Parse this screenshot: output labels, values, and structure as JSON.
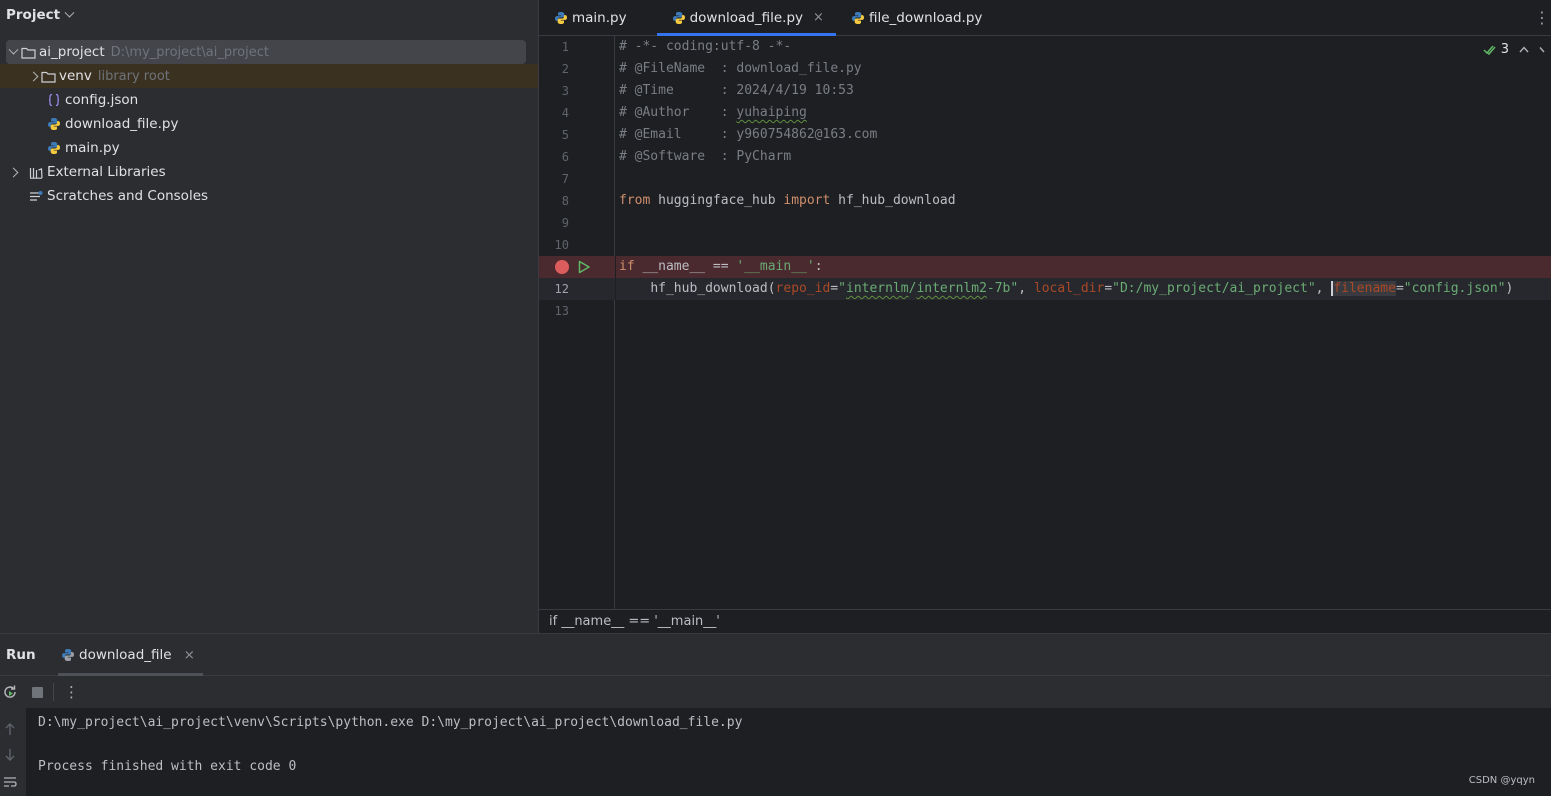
{
  "project": {
    "title": "Project",
    "tree": [
      {
        "name": "ai_project",
        "hint": "D:\\my_project\\ai_project"
      },
      {
        "name": "venv",
        "hint": "library root"
      },
      {
        "name": "config.json"
      },
      {
        "name": "download_file.py"
      },
      {
        "name": "main.py"
      },
      {
        "name": "External Libraries"
      },
      {
        "name": "Scratches and Consoles"
      }
    ]
  },
  "editor": {
    "tabs": [
      {
        "label": "main.py"
      },
      {
        "label": "download_file.py"
      },
      {
        "label": "file_download.py"
      }
    ],
    "close_symbol": "×",
    "more_symbol": "⋮",
    "check_count": "3",
    "line_numbers": [
      "1",
      "2",
      "3",
      "4",
      "5",
      "6",
      "7",
      "8",
      "9",
      "10",
      "11",
      "12",
      "13"
    ],
    "code": {
      "l1": "# -*- coding:utf-8 -*-",
      "l2": "# @FileName  : download_file.py",
      "l3": "# @Time      : 2024/4/19 10:53",
      "l4_a": "# @Author    : ",
      "l4_b": "yuhaiping",
      "l5": "# @Email     : y960754862@163.com",
      "l6": "# @Software  : PyCharm",
      "l8_from": "from",
      "l8_mod": " huggingface_hub ",
      "l8_import": "import",
      "l8_name": " hf_hub_download",
      "l11_if": "if",
      "l11_rest": " __name__ == ",
      "l11_str": "'__main__'",
      "l11_colon": ":",
      "l12_indent": "    ",
      "l12_fn": "hf_hub_download(",
      "l12_p1": "repo_id",
      "l12_eq1": "=",
      "l12_q1": "\"",
      "l12_v1a": "internlm",
      "l12_slash": "/",
      "l12_v1b": "internlm2",
      "l12_v1c": "-7b\"",
      "l12_sep1": ", ",
      "l12_p2": "local_dir",
      "l12_eq2": "=",
      "l12_v2": "\"D:/my_project/ai_project\"",
      "l12_sep2": ", ",
      "l12_p3": "filename",
      "l12_eq3": "=",
      "l12_v3": "\"config.json\"",
      "l12_end": ")"
    },
    "breadcrumb": "if __name__ == '__main__'"
  },
  "run": {
    "title": "Run",
    "tab_label": "download_file",
    "console": [
      "D:\\my_project\\ai_project\\venv\\Scripts\\python.exe D:\\my_project\\ai_project\\download_file.py",
      "",
      "Process finished with exit code 0"
    ]
  },
  "watermark": "CSDN @yqyn",
  "colors": {
    "accent": "#3574f0",
    "breakpoint": "#db5c5c",
    "run_green": "#5fb865",
    "python_blue": "#3d7ab8",
    "python_yellow": "#f5c940"
  }
}
